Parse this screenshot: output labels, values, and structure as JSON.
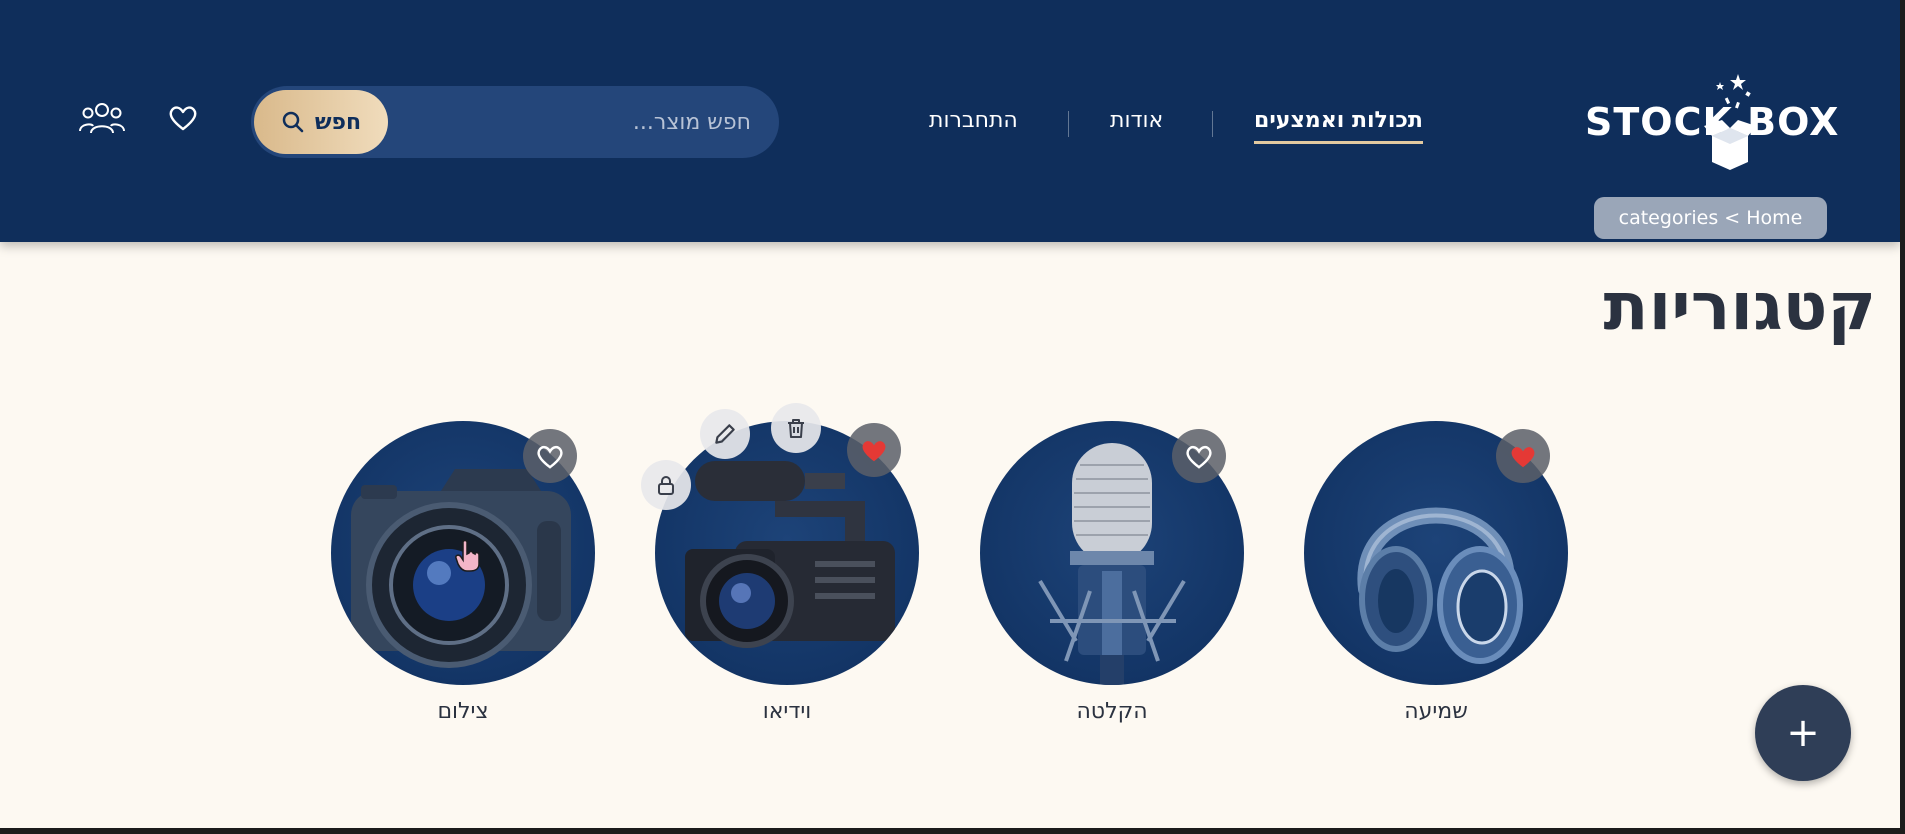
{
  "header": {
    "logo_text": "STOCK BOX",
    "nav": [
      {
        "label": "תכולות ואמצעים",
        "active": true
      },
      {
        "label": "אודות"
      },
      {
        "label": "התחברות"
      }
    ],
    "search": {
      "placeholder": "חפש מוצר...",
      "button_label": "חפש"
    },
    "icons": [
      "users-icon",
      "heart-icon",
      "search-icon"
    ]
  },
  "breadcrumb": "categories < Home",
  "page_title": "קטגוריות",
  "categories": [
    {
      "label": "שמיעה",
      "icon": "headphones-icon",
      "favorite": true
    },
    {
      "label": "הקלטה",
      "icon": "microphone-icon",
      "favorite": false
    },
    {
      "label": "וידיאו",
      "icon": "video-camera-icon",
      "favorite": true,
      "actions": [
        "lock-icon",
        "pencil-icon",
        "trash-icon"
      ]
    },
    {
      "label": "צילום",
      "icon": "camera-icon",
      "favorite": false
    }
  ],
  "fab_label": "+",
  "colors": {
    "header_bg": "#0f2e5b",
    "page_bg": "#fdf9f2",
    "accent_gold": "#d9b98b",
    "favorite_red": "#e53935",
    "fab_bg": "#2f3e57"
  }
}
